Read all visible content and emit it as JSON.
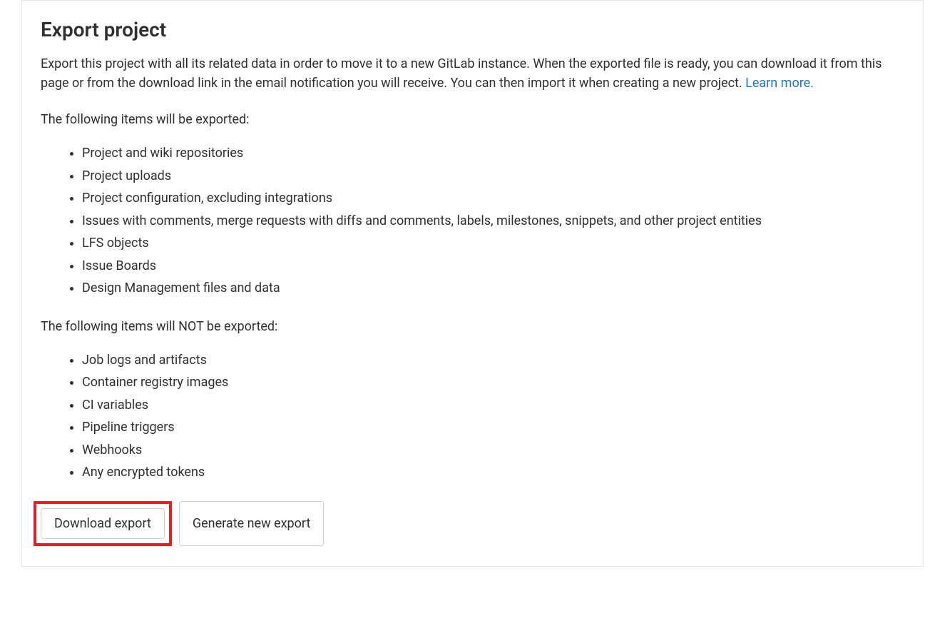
{
  "heading": "Export project",
  "description_text": "Export this project with all its related data in order to move it to a new GitLab instance. When the exported file is ready, you can download it from this page or from the download link in the email notification you will receive. You can then import it when creating a new project. ",
  "learn_more_label": "Learn more.",
  "exported_label": "The following items will be exported:",
  "exported_items": [
    "Project and wiki repositories",
    "Project uploads",
    "Project configuration, excluding integrations",
    "Issues with comments, merge requests with diffs and comments, labels, milestones, snippets, and other project entities",
    "LFS objects",
    "Issue Boards",
    "Design Management files and data"
  ],
  "not_exported_label": "The following items will NOT be exported:",
  "not_exported_items": [
    "Job logs and artifacts",
    "Container registry images",
    "CI variables",
    "Pipeline triggers",
    "Webhooks",
    "Any encrypted tokens"
  ],
  "buttons": {
    "download_export": "Download export",
    "generate_new_export": "Generate new export"
  }
}
